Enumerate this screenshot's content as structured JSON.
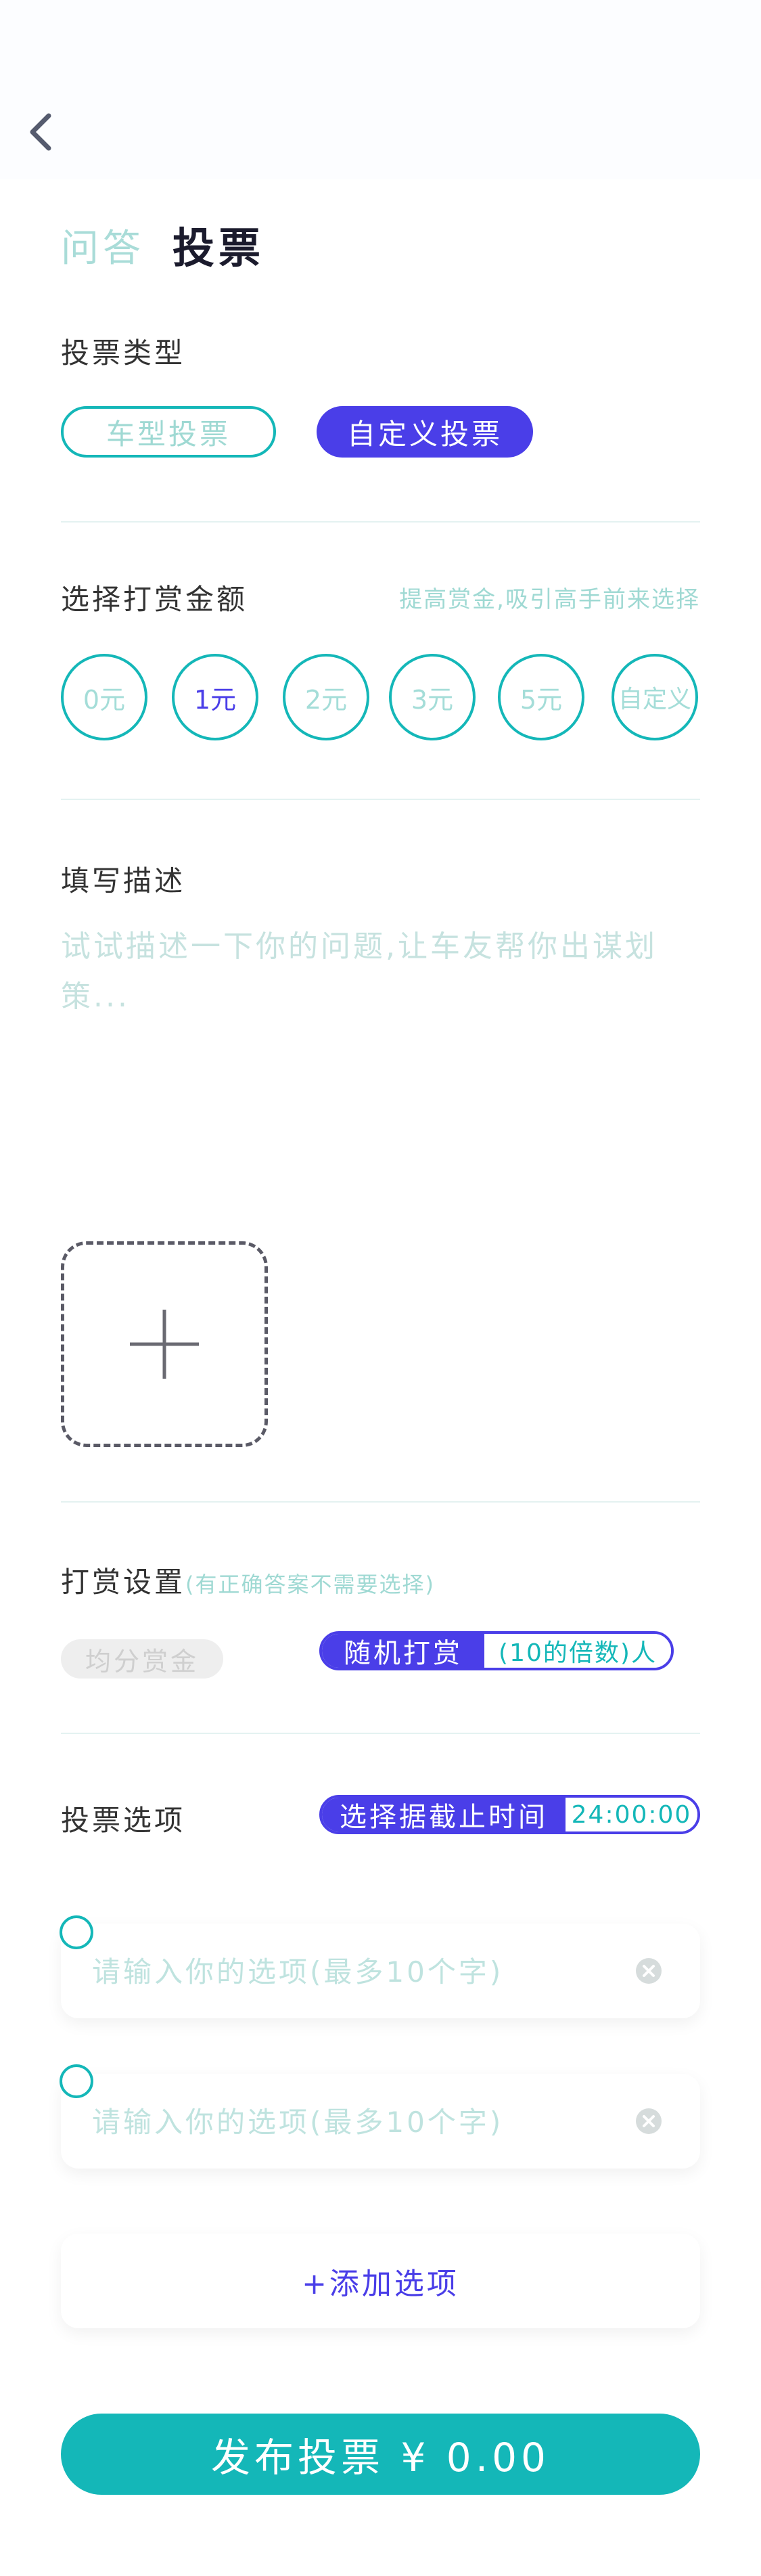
{
  "tabs": {
    "qa": "问答",
    "vote": "投票"
  },
  "vote_type": {
    "title": "投票类型",
    "options": [
      "车型投票",
      "自定义投票"
    ],
    "selected": "自定义投票"
  },
  "reward_amount": {
    "title": "选择打赏金额",
    "hint": "提高赏金,吸引高手前来选择",
    "options": [
      "0元",
      "1元",
      "2元",
      "3元",
      "5元",
      "自定义"
    ],
    "selected": "1元"
  },
  "description": {
    "title": "填写描述",
    "placeholder": "试试描述一下你的问题,让车友帮你出谋划策..."
  },
  "reward_settings": {
    "title": "打赏设置",
    "note": "(有正确答案不需要选择)",
    "equal_split": "均分赏金",
    "random_label": "随机打赏",
    "random_count": "(10的倍数)人"
  },
  "vote_options": {
    "title": "投票选项",
    "deadline_label": "选择据截止时间",
    "deadline_value": "24:00:00",
    "input_placeholder": "请输入你的选项(最多10个字)",
    "add_option": "+添加选项"
  },
  "publish": {
    "label": "发布投票 ¥ 0.00"
  },
  "colors": {
    "accent_teal": "#14b7b8",
    "accent_purple": "#4a3ee8",
    "muted_teal": "#9fd9d3"
  }
}
